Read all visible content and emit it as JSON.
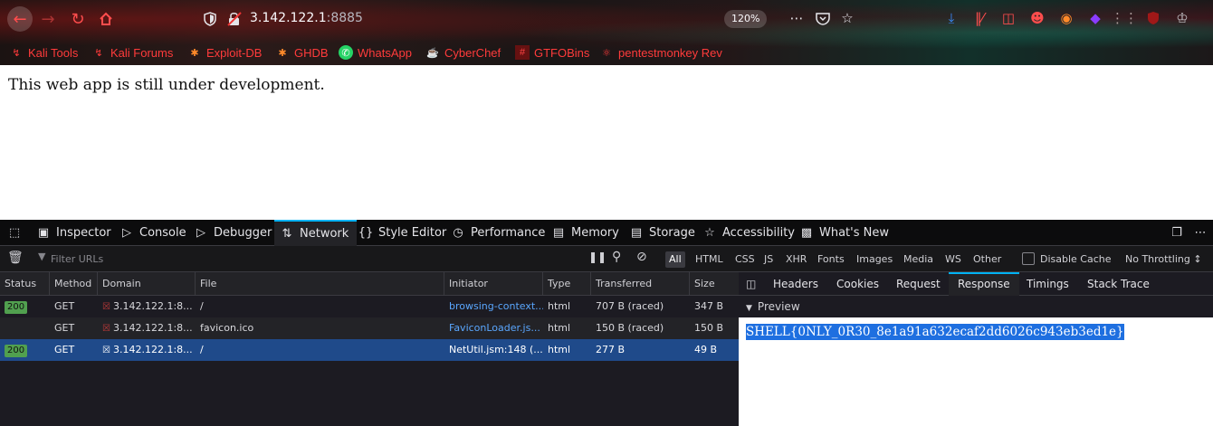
{
  "browser": {
    "url_host": "3.142.122.1",
    "url_port": ":8885",
    "zoom": "120%",
    "bookmarks": [
      {
        "label": "Kali Tools",
        "icon": "kali-dragon-icon"
      },
      {
        "label": "Kali Forums",
        "icon": "kali-dragon-icon"
      },
      {
        "label": "Exploit-DB",
        "icon": "exploitdb-icon"
      },
      {
        "label": "GHDB",
        "icon": "ghdb-icon"
      },
      {
        "label": "WhatsApp",
        "icon": "whatsapp-icon"
      },
      {
        "label": "CyberChef",
        "icon": "cyberchef-icon"
      },
      {
        "label": "GTFOBins",
        "icon": "gtfobins-icon"
      },
      {
        "label": "pentestmonkey Rev",
        "icon": "globe-icon"
      }
    ]
  },
  "page": {
    "text": "This web app is still under development."
  },
  "devtools": {
    "tabs": [
      {
        "label": "Inspector",
        "icon": "inspector-icon"
      },
      {
        "label": "Console",
        "icon": "console-icon"
      },
      {
        "label": "Debugger",
        "icon": "debugger-icon"
      },
      {
        "label": "Network",
        "icon": "network-icon"
      },
      {
        "label": "Style Editor",
        "icon": "style-editor-icon"
      },
      {
        "label": "Performance",
        "icon": "performance-icon"
      },
      {
        "label": "Memory",
        "icon": "memory-icon"
      },
      {
        "label": "Storage",
        "icon": "storage-icon"
      },
      {
        "label": "Accessibility",
        "icon": "accessibility-icon"
      },
      {
        "label": "What's New",
        "icon": "gift-icon"
      }
    ],
    "active_tab": "Network",
    "filter_placeholder": "Filter URLs",
    "type_filters": [
      "All",
      "HTML",
      "CSS",
      "JS",
      "XHR",
      "Fonts",
      "Images",
      "Media",
      "WS",
      "Other"
    ],
    "disable_cache_label": "Disable Cache",
    "throttling_label": "No Throttling ↕",
    "columns": [
      "Status",
      "Method",
      "Domain",
      "File",
      "Initiator",
      "Type",
      "Transferred",
      "Size"
    ],
    "requests": [
      {
        "status": "200",
        "method": "GET",
        "domain": "3.142.122.1:8...",
        "file": "/",
        "initiator": "browsing-context...",
        "type": "html",
        "transferred": "707 B (raced)",
        "size": "347 B"
      },
      {
        "status": "",
        "method": "GET",
        "domain": "3.142.122.1:8...",
        "file": "favicon.ico",
        "initiator": "FaviconLoader.js...",
        "type": "html",
        "transferred": "150 B (raced)",
        "size": "150 B"
      },
      {
        "status": "200",
        "method": "GET",
        "domain": "3.142.122.1:8...",
        "file": "/",
        "initiator": "NetUtil.jsm:148 (...",
        "type": "html",
        "transferred": "277 B",
        "size": "49 B"
      }
    ],
    "detail_tabs": [
      "Headers",
      "Cookies",
      "Request",
      "Response",
      "Timings",
      "Stack Trace"
    ],
    "active_detail_tab": "Response",
    "preview_label": "Preview",
    "response_text": "SHELL{0NLY_0R30_8e1a91a632ecaf2dd6026c943eb3ed1e}"
  },
  "colors": {
    "bookmark_text": "#ff3b3b",
    "active_tab_accent": "#00b3f4",
    "selected_row": "#1f4a8a",
    "status_ok": "#51a04f",
    "selection_highlight": "#1e6fe0"
  }
}
